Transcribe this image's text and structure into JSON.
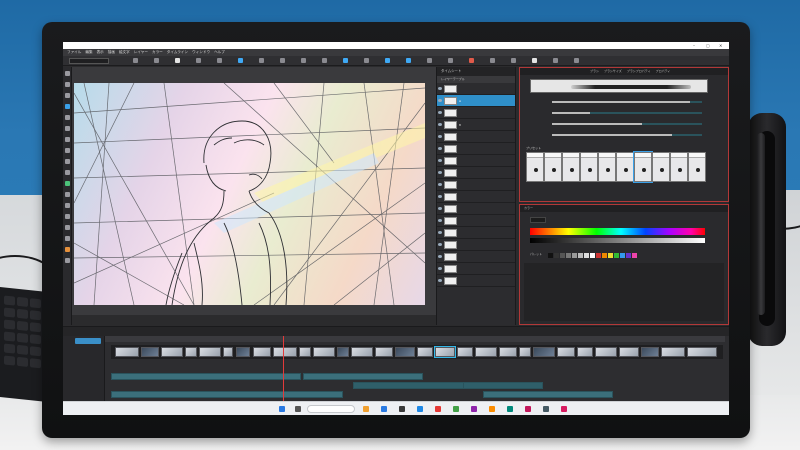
{
  "app": {
    "window_title": "",
    "menu_items": [
      "ファイル",
      "編集",
      "表示",
      "描画",
      "絵文字",
      "レイヤー",
      "カラー",
      "タイムライン",
      "ウィンドウ",
      "ヘルプ"
    ],
    "tool_field": ""
  },
  "layers_panel": {
    "header": "タイムシート",
    "tab": "レイヤーテーブル",
    "rows": [
      {
        "label": ""
      },
      {
        "label": "A",
        "selected": true
      },
      {
        "label": ""
      },
      {
        "label": "B"
      },
      {
        "label": ""
      },
      {
        "label": ""
      },
      {
        "label": ""
      },
      {
        "label": ""
      },
      {
        "label": ""
      },
      {
        "label": ""
      },
      {
        "label": ""
      },
      {
        "label": ""
      },
      {
        "label": ""
      },
      {
        "label": ""
      },
      {
        "label": ""
      },
      {
        "label": ""
      },
      {
        "label": ""
      }
    ]
  },
  "brush_panel": {
    "tabs": [
      "ブラシ",
      "ブラシサイズ",
      "ブラシプロパティ",
      "プロパティ"
    ],
    "sliders": [
      {
        "label": "",
        "value": 0.92
      },
      {
        "label": "",
        "value": 0.25
      },
      {
        "label": "",
        "value": 0.6
      },
      {
        "label": "",
        "value": 0.8
      }
    ],
    "preset_header": "プリセット",
    "presets": [
      "",
      "",
      "",
      "",
      "",
      "",
      "",
      "",
      "",
      ""
    ]
  },
  "color_panel": {
    "header": "カラー",
    "palette_label": "パレット"
  },
  "timeline": {
    "badge": "",
    "timecodes": [
      "",
      "",
      "",
      "",
      ""
    ],
    "tracks": [
      {
        "label": "",
        "row": 0
      },
      {
        "label": "",
        "row": 0
      },
      {
        "label": "",
        "row": 1
      },
      {
        "label": "",
        "row": 1
      },
      {
        "label": "",
        "row": 2
      },
      {
        "label": "",
        "row": 2
      }
    ]
  },
  "canvas": {
    "zoom_label": ""
  },
  "taskbar": {
    "search_placeholder": "",
    "time": "",
    "date": ""
  },
  "colors": {
    "accent": "#2f8fc9",
    "panel_border": "#b23838",
    "playhead": "#e23a3a",
    "wall": "#2a78b4"
  },
  "icons": [
    "pen-icon",
    "eraser-icon",
    "brush-icon",
    "fill-icon",
    "eyedropper-icon",
    "move-icon",
    "zoom-icon",
    "layer-eye-icon",
    "play-icon",
    "search-icon",
    "windows-start-icon",
    "close-icon",
    "minimize-icon",
    "maximize-icon"
  ]
}
